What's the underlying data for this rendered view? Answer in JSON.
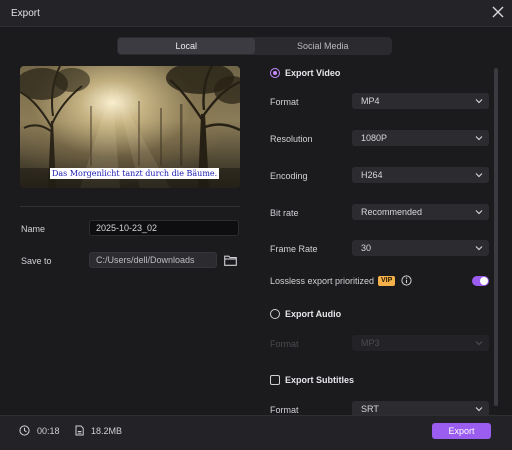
{
  "window": {
    "title": "Export"
  },
  "tabs": [
    {
      "label": "Local",
      "active": true
    },
    {
      "label": "Social Media",
      "active": false
    }
  ],
  "preview": {
    "subtitle_text": "Das Morgenlicht tanzt durch die Bäume."
  },
  "file": {
    "name_label": "Name",
    "name_value": "2025-10-23_02",
    "save_to_label": "Save to",
    "save_to_value": "C:/Users/dell/Downloads"
  },
  "video": {
    "section_label": "Export Video",
    "checked": true,
    "format_label": "Format",
    "format_value": "MP4",
    "resolution_label": "Resolution",
    "resolution_value": "1080P",
    "encoding_label": "Encoding",
    "encoding_value": "H264",
    "bitrate_label": "Bit rate",
    "bitrate_value": "Recommended",
    "framerate_label": "Frame Rate",
    "framerate_value": "30",
    "lossless_label": "Lossless export prioritized",
    "vip_badge": "VIP",
    "lossless_enabled": true
  },
  "audio": {
    "section_label": "Export Audio",
    "checked": false,
    "format_label": "Format",
    "format_value": "MP3"
  },
  "subtitles": {
    "section_label": "Export Subtitles",
    "checked": false,
    "format_label": "Format",
    "format_value": "SRT"
  },
  "footer": {
    "duration": "00:18",
    "file_size": "18.2MB",
    "export_label": "Export"
  },
  "colors": {
    "accent": "#9b5cf0",
    "vip": "#f5b14a",
    "background": "#1b1b1e"
  },
  "icons": [
    "close-icon",
    "folder-icon",
    "info-icon",
    "clock-icon",
    "file-size-icon",
    "chevron-down-icon"
  ]
}
